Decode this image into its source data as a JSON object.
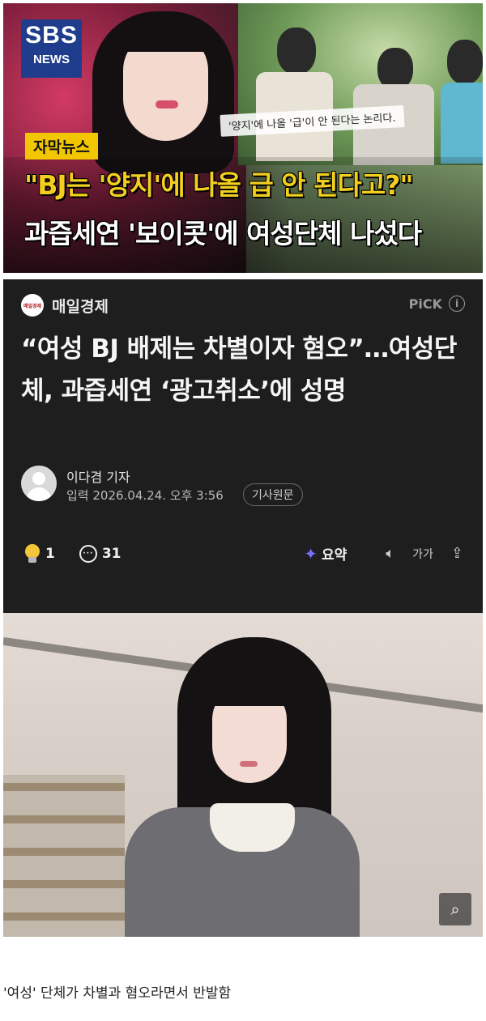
{
  "thumbnail": {
    "logo_line1": "SBS",
    "logo_line2": "NEWS",
    "tag": "자막뉴스",
    "caption": "'양지'에 나올 '급'이 안 된다는 논리다.",
    "headline_1": "\"BJ는 '양지'에 나올 급 안 된다고?\"",
    "headline_2": "과즙세연 '보이콧'에 여성단체 나섰다"
  },
  "article": {
    "press_logo_text": "매일경제",
    "press_name": "매일경제",
    "pick_label": "PiCK",
    "pick_info": "i",
    "title": "“여성 BJ 배제는 차별이자 혐오”…여성단체, 과즙세연 ‘광고취소’에 성명",
    "author": "이다겸 기자",
    "dateline": "입력 2026.04.24. 오후 3:56",
    "original_button": "기사원문",
    "reaction_count": "1",
    "comment_count": "31",
    "summary_label": "요약",
    "font_size_label": "가가"
  },
  "photo": {
    "zoom_icon": "search-icon"
  },
  "caption_below": "'여성' 단체가 차별과 혐오라면서 반발함",
  "colors": {
    "card_bg": "#1e1e1e",
    "sbs_blue": "#1f3d8c",
    "headline_yellow": "#f2cf1f"
  }
}
